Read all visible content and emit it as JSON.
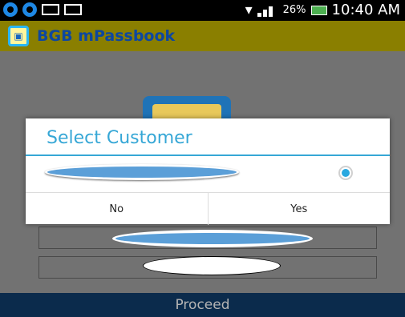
{
  "status_bar": {
    "battery_percent": "26%",
    "time": "10:40 AM"
  },
  "app": {
    "title": "BGB mPassbook",
    "logo_icon": "bank-logo-icon"
  },
  "dialog": {
    "title": "Select Customer",
    "customer_option_selected": true,
    "buttons": {
      "no_label": "No",
      "yes_label": "Yes"
    }
  },
  "footer": {
    "proceed_label": "Proceed"
  },
  "colors": {
    "appbar": "#8a7f00",
    "accent": "#36a7d6",
    "footer": "#0b2b4c"
  }
}
